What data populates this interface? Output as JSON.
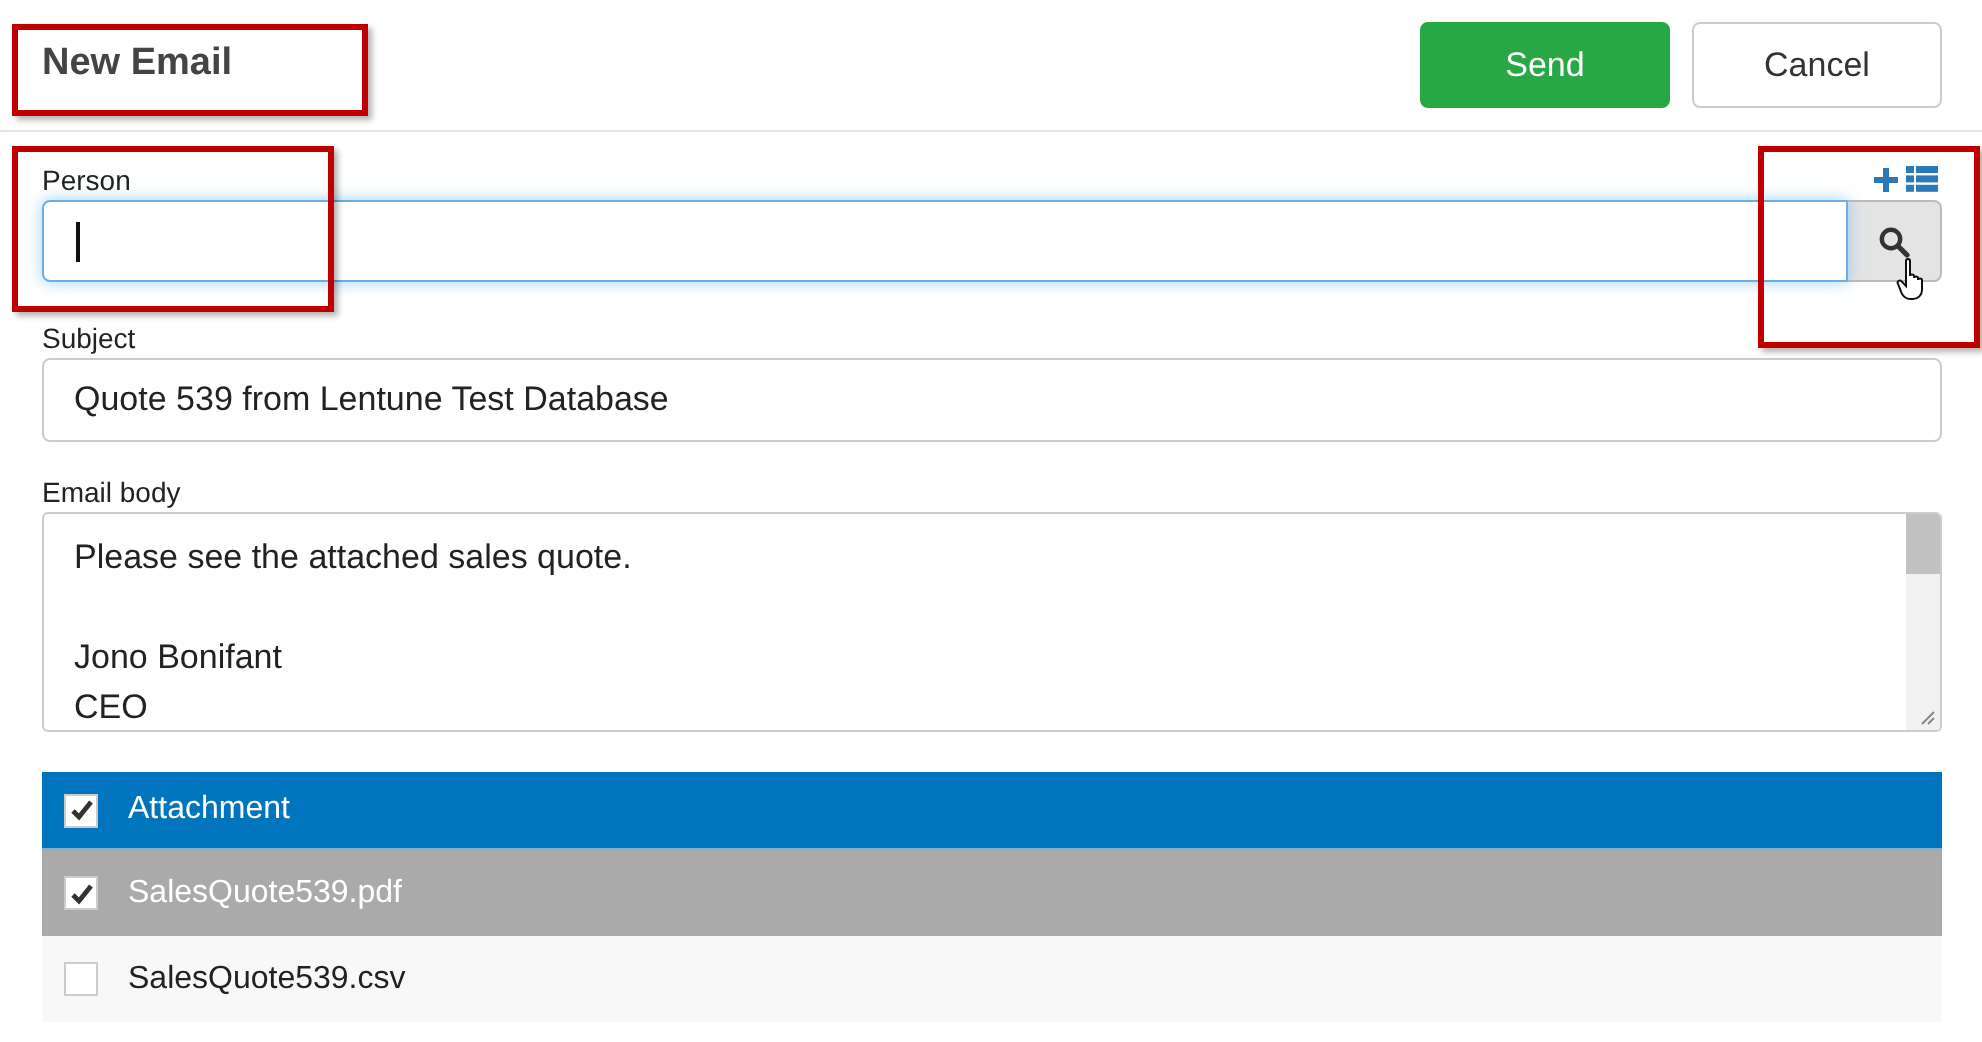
{
  "header": {
    "title": "New Email",
    "buttons": [
      {
        "label": "Send",
        "kind": "primary"
      },
      {
        "label": "Cancel",
        "kind": "default"
      }
    ]
  },
  "person": {
    "label": "Person",
    "focused": true
  },
  "subject": {
    "label": "Subject",
    "value": "Quote 539 from Lentune Test Database"
  },
  "body": {
    "label": "Email body",
    "paragraphs": [
      [
        "Please see the attached sales quote."
      ],
      [
        "Jono Bonifant",
        "CEO"
      ]
    ]
  },
  "attachments": [
    {
      "kind": "header",
      "label": "Attachment",
      "checked": true
    },
    {
      "kind": "file",
      "label": "SalesQuote539.pdf",
      "checked": true,
      "selected": true
    },
    {
      "kind": "file",
      "label": "SalesQuote539.csv",
      "checked": false,
      "selected": false
    }
  ]
}
